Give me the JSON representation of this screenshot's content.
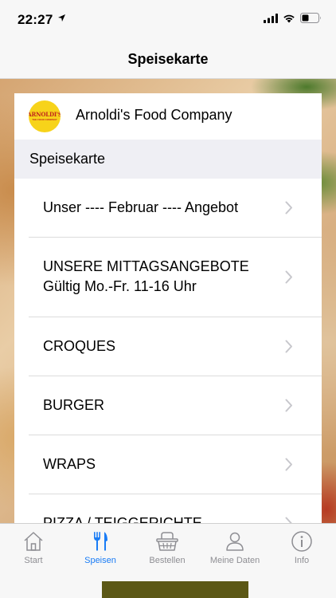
{
  "status_bar": {
    "time": "22:27"
  },
  "nav": {
    "title": "Speisekarte"
  },
  "restaurant": {
    "name": "Arnoldi's Food Company",
    "logo_text": "ARNOLDI'S",
    "logo_subtext": "THE FOOD COMPANY"
  },
  "section": {
    "title": "Speisekarte"
  },
  "menu_items": [
    {
      "line1": "Unser ---- Februar ---- Angebot",
      "line2": ""
    },
    {
      "line1": "UNSERE MITTAGSANGEBOTE",
      "line2": "Gültig Mo.-Fr. 11-16 Uhr"
    },
    {
      "line1": "CROQUES",
      "line2": ""
    },
    {
      "line1": "BURGER",
      "line2": ""
    },
    {
      "line1": "WRAPS",
      "line2": ""
    },
    {
      "line1": "PIZZA / TEIGGERICHTE",
      "line2": ""
    }
  ],
  "tabs": [
    {
      "label": "Start",
      "icon": "house-icon"
    },
    {
      "label": "Speisen",
      "icon": "fork-knife-icon",
      "active": true
    },
    {
      "label": "Bestellen",
      "icon": "basket-icon"
    },
    {
      "label": "Meine Daten",
      "icon": "person-icon"
    },
    {
      "label": "Info",
      "icon": "info-icon"
    }
  ],
  "colors": {
    "accent": "#1a7cf5",
    "tab_inactive": "#8e8e93",
    "logo_yellow": "#f7d31a",
    "logo_red": "#c0261c",
    "section_bg": "#efeff4"
  }
}
